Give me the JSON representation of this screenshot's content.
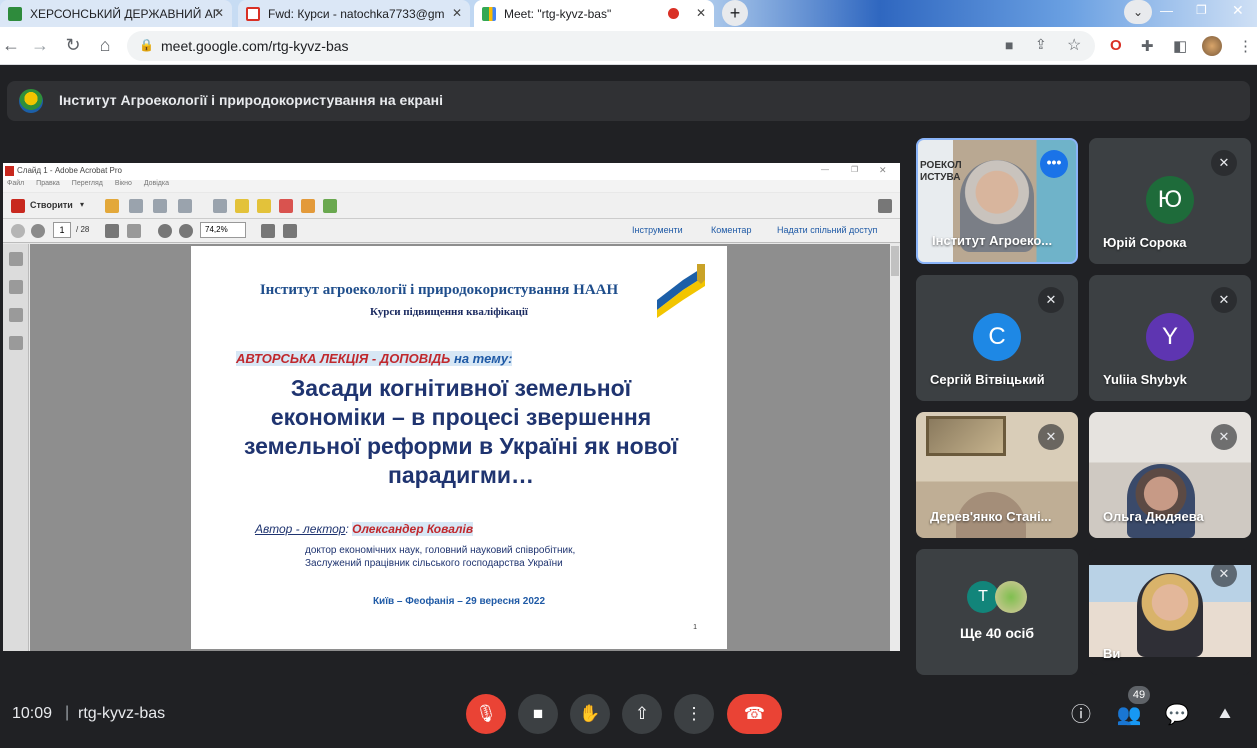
{
  "browser": {
    "tabs": [
      {
        "title": "ХЕРСОНСЬКИЙ ДЕРЖАВНИЙ АГ",
        "active": false
      },
      {
        "title": "Fwd: Курси - natochka7733@gm",
        "active": false
      },
      {
        "title": "Meet: \"rtg-kyvz-bas\"",
        "active": true
      }
    ],
    "new_tab_icon": "+",
    "url": "meet.google.com/rtg-kyvz-bas"
  },
  "meet": {
    "banner_text": "Інститут Агроекології і природокористування на екрані",
    "time": "10:09",
    "separator": "|",
    "meeting_code": "rtg-kyvz-bas",
    "people_count": "49"
  },
  "acrobat": {
    "title": "Слайд 1 - Adobe Acrobat Pro",
    "menu": [
      "Файл",
      "Правка",
      "Перегляд",
      "Вікно",
      "Довідка"
    ],
    "create_label": "Створити",
    "page_current": "1",
    "page_total": "/ 28",
    "zoom": "74,2%",
    "links": [
      "Інструменти",
      "Коментар",
      "Надати спільний доступ"
    ]
  },
  "slide": {
    "institute": "Інститут агроекології і природокористування НААН",
    "course": "Курси підвищення кваліфікації",
    "lecture_label": "АВТОРСЬКА ЛЕКЦІЯ - ДОПОВІДЬ",
    "lecture_label_suffix": " на тему:",
    "title": "Засади когнітивної земельної економіки – в процесі звершення земельної реформи в Україні як нової парадигми…",
    "lector_label": "Автор - лектор",
    "lector_colon": ": ",
    "lector_name": "Олександер Ковалів",
    "degree_line1": "доктор економічних наук, головний науковий співробітник,",
    "degree_line2": "Заслужений працівник сільського господарства України",
    "place_date": "Київ – Феофанія – 29 вересня 2022",
    "page_number": "1"
  },
  "participants": [
    {
      "name": "Інститут Агроеко...",
      "type": "video"
    },
    {
      "name": "Юрій Сорока",
      "initial": "Ю",
      "color": "#1e6b3a"
    },
    {
      "name": "Сергій Вітвіцький",
      "initial": "С",
      "color": "#1e88e5"
    },
    {
      "name": "Yuliia Shybyk",
      "initial": "Y",
      "color": "#5e35b1"
    },
    {
      "name": "Дерев'янко Стані...",
      "type": "video"
    },
    {
      "name": "Ольга Дюдяева",
      "type": "video"
    },
    {
      "name": "Ще 40 осіб",
      "initial": "Т",
      "color": "#12857a"
    },
    {
      "name": "Ви",
      "type": "video"
    }
  ]
}
